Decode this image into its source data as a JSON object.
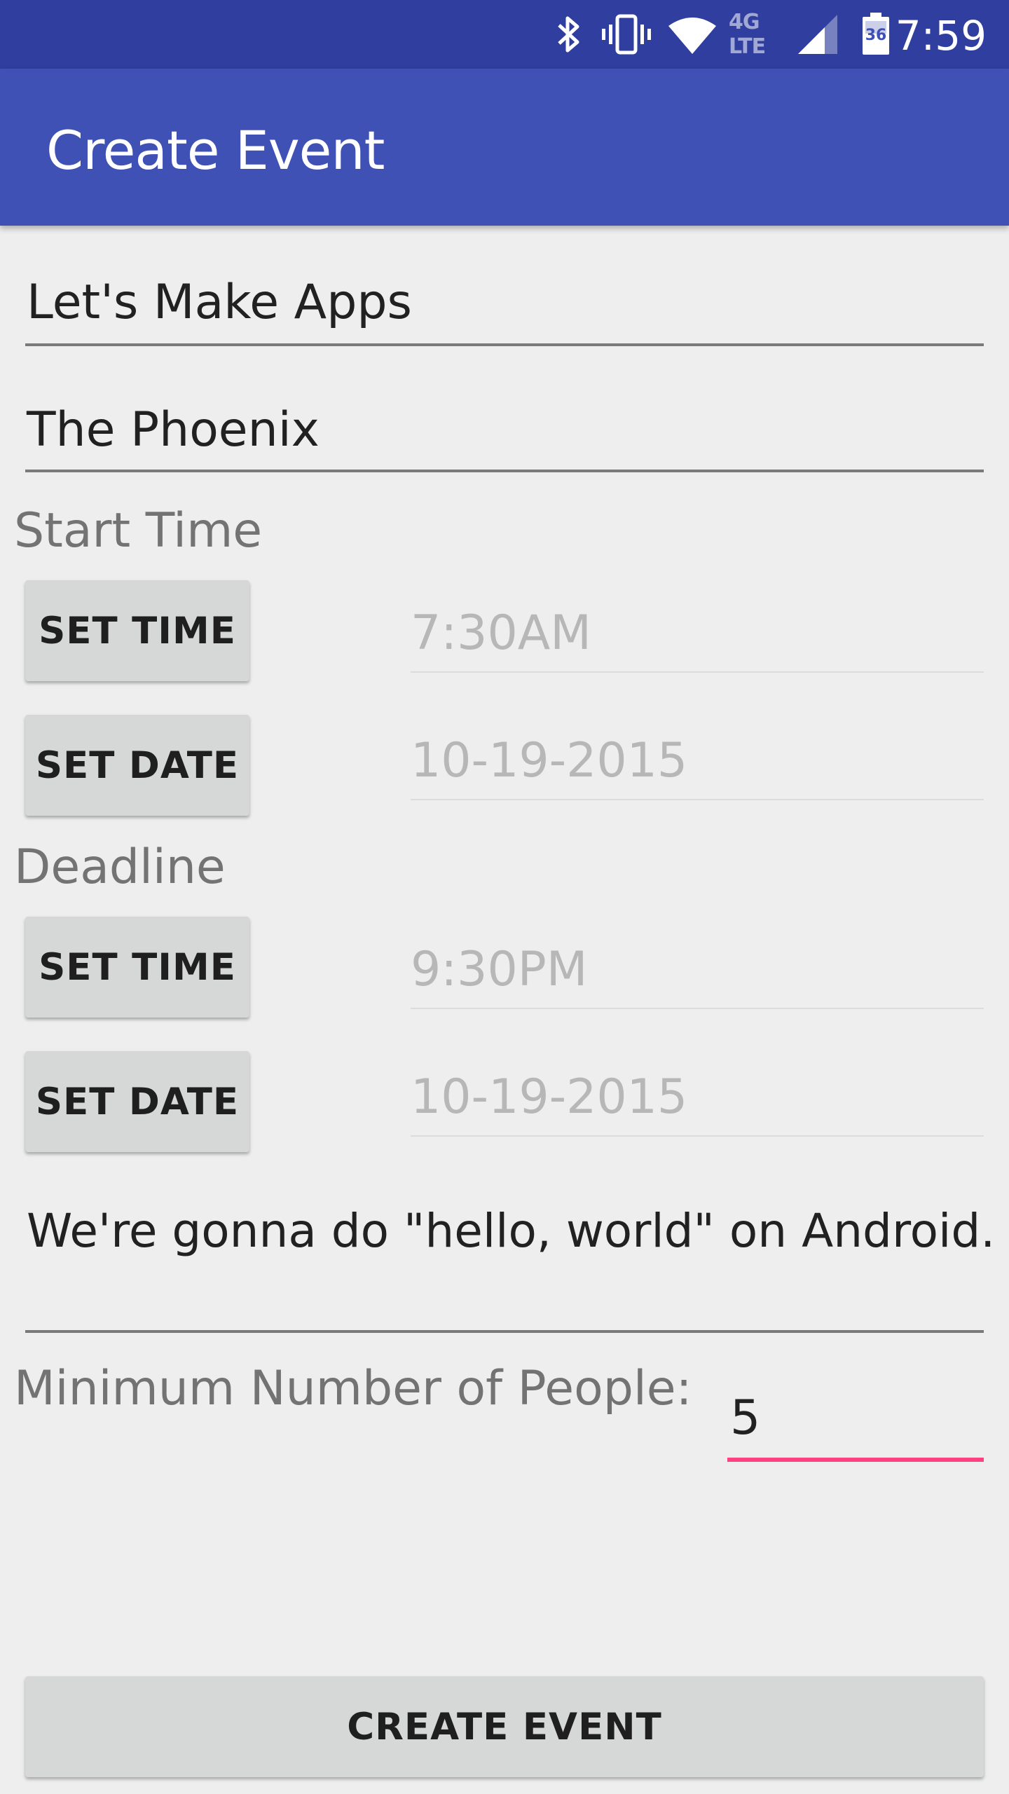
{
  "status_bar": {
    "time": "7:59",
    "network_label": "4G LTE",
    "battery_level": "36",
    "icons": [
      "bluetooth-icon",
      "vibrate-icon",
      "wifi-icon",
      "network-type-icon",
      "signal-icon",
      "battery-icon"
    ]
  },
  "app_bar": {
    "title": "Create Event"
  },
  "form": {
    "event_name": "Let's Make Apps",
    "location": "The Phoenix",
    "start_label": "Start Time",
    "start_time_button": "SET TIME",
    "start_time_value": "7:30AM",
    "start_date_button": "SET DATE",
    "start_date_value": "10-19-2015",
    "deadline_label": "Deadline",
    "deadline_time_button": "SET TIME",
    "deadline_time_value": "9:30PM",
    "deadline_date_button": "SET DATE",
    "deadline_date_value": "10-19-2015",
    "description": "We're gonna do \"hello, world\" on Android.",
    "min_people_label": "Minimum Number of People:",
    "min_people_value": "5",
    "create_button": "CREATE EVENT"
  },
  "colors": {
    "status_bar": "#303f9f",
    "app_bar": "#3f51b5",
    "accent": "#ff4081",
    "background": "#eeeeee",
    "button": "#d6d7d7"
  }
}
